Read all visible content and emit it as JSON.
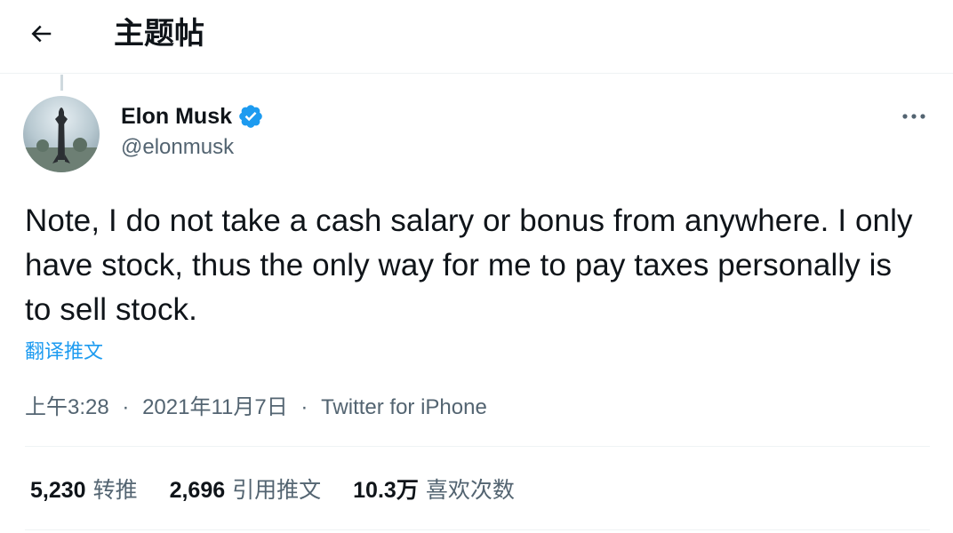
{
  "header": {
    "title": "主题帖",
    "back_icon": "arrow-left-icon"
  },
  "tweet": {
    "author": {
      "display_name": "Elon Musk",
      "handle": "@elonmusk",
      "verified": true,
      "verified_color": "#1d9bf0"
    },
    "text": "Note, I do not take a cash salary or bonus from anywhere. I only have stock, thus the only way for me to pay taxes personally is to sell stock.",
    "translate_label": "翻译推文",
    "time": "上午3:28",
    "date": "2021年11月7日",
    "separator": "·",
    "source": "Twitter for iPhone",
    "stats": {
      "retweets": {
        "value": "5,230",
        "label": "转推"
      },
      "quotes": {
        "value": "2,696",
        "label": "引用推文"
      },
      "likes": {
        "value": "10.3万",
        "label": "喜欢次数"
      }
    }
  },
  "colors": {
    "accent": "#1d9bf0",
    "text_primary": "#0f1419",
    "text_secondary": "#536471",
    "border": "#eff3f4"
  }
}
